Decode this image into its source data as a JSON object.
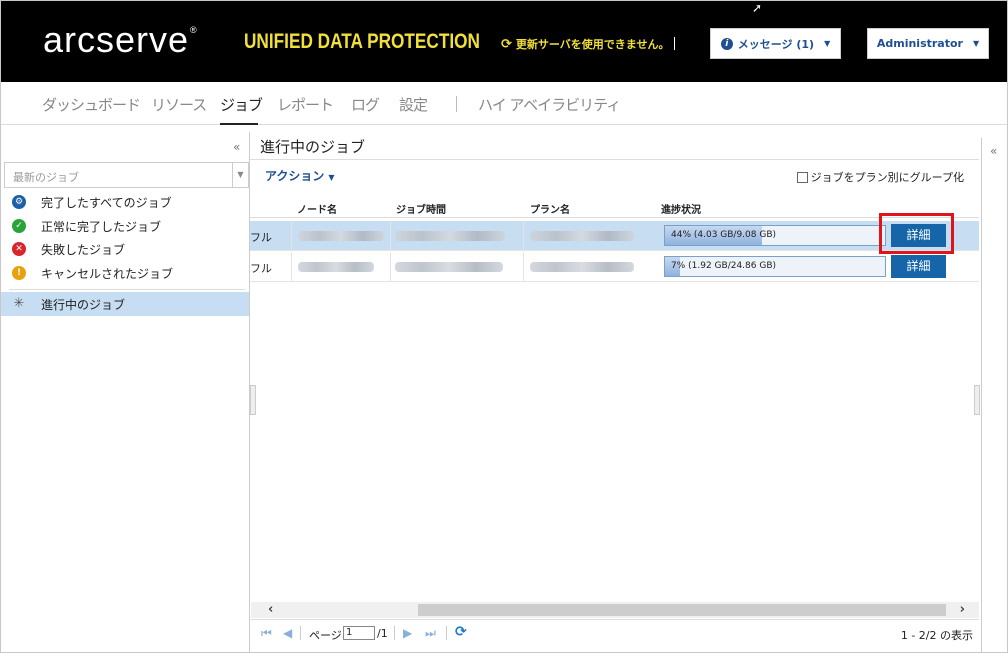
{
  "header": {
    "logo": "arcserve",
    "logo_mark": "®",
    "product": "UNIFIED DATA PROTECTION",
    "update_status": "更新サーバを使用できません。",
    "messages_button": "メッセージ (1)",
    "user_button": "Administrator"
  },
  "nav": {
    "tabs": [
      "ダッシュボード",
      "リソース",
      "ジョブ",
      "レポート",
      "ログ",
      "設定",
      "ハイ アベイラビリティ"
    ],
    "active": "ジョブ"
  },
  "left": {
    "filter_placeholder": "最新のジョブ",
    "items": [
      {
        "label": "完了したすべてのジョブ",
        "icon": "gear-icon",
        "color": "#1d5fa8"
      },
      {
        "label": "正常に完了したジョブ",
        "icon": "check-icon",
        "color": "#2aa33b"
      },
      {
        "label": "失敗したジョブ",
        "icon": "x-icon",
        "color": "#d9262c"
      },
      {
        "label": "キャンセルされたジョブ",
        "icon": "exclamation-icon",
        "color": "#e8a10b"
      }
    ],
    "in_progress": "進行中のジョブ"
  },
  "main": {
    "title": "進行中のジョブ",
    "action_label": "アクション",
    "group_checkbox": "ジョブをプラン別にグループ化",
    "columns": [
      "ノード名",
      "ジョブ時間",
      "プラン名",
      "進捗状況"
    ],
    "rows": [
      {
        "type": "フル",
        "progress_text": "44% (4.03 GB/9.08 GB)",
        "progress": 0.44,
        "button": "詳細"
      },
      {
        "type": "フル",
        "progress_text": "7% (1.92 GB/24.86 GB)",
        "progress": 0.07,
        "button": "詳細"
      }
    ]
  },
  "pager": {
    "page_label": "ページ",
    "page_value": "1",
    "page_total": "/1",
    "display": "1 - 2/2 の表示"
  }
}
